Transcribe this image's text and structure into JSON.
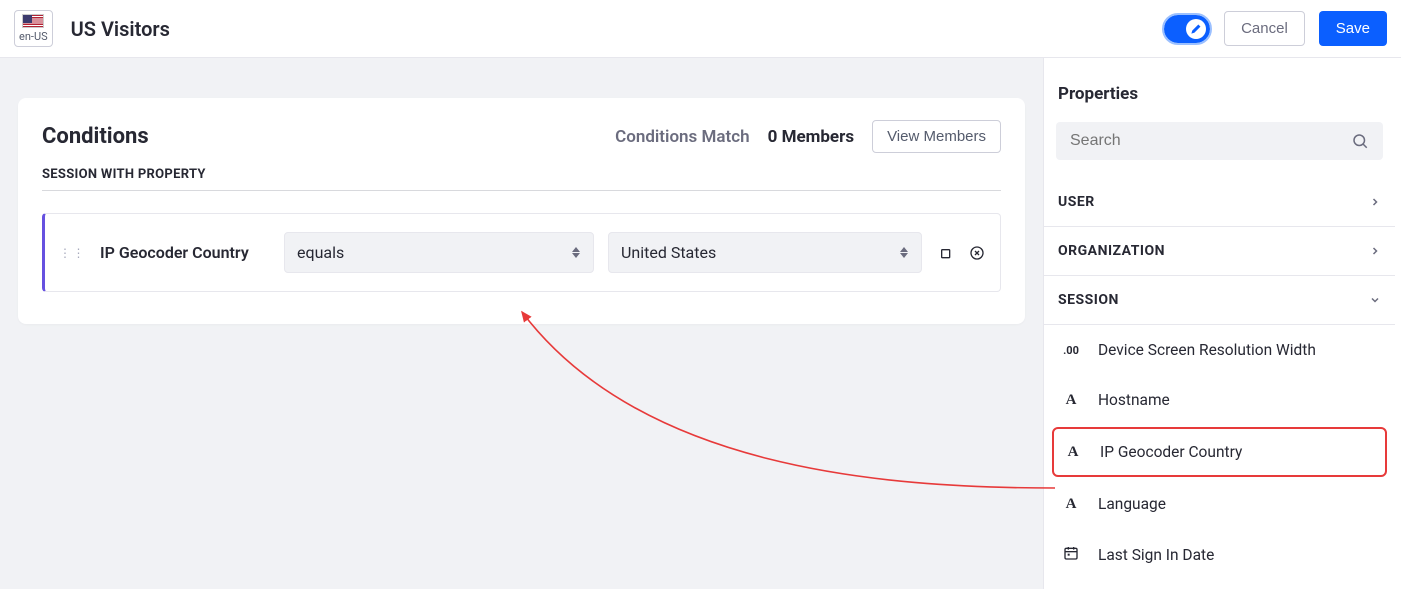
{
  "header": {
    "locale": "en-US",
    "title": "US Visitors",
    "cancel_label": "Cancel",
    "save_label": "Save"
  },
  "conditions": {
    "title": "Conditions",
    "match_label": "Conditions Match",
    "match_count": "0 Members",
    "view_members_label": "View Members",
    "section_label": "SESSION WITH PROPERTY",
    "row": {
      "property_label": "IP Geocoder Country",
      "operator": "equals",
      "value": "United States"
    }
  },
  "sidebar": {
    "title": "Properties",
    "search_placeholder": "Search",
    "groups": {
      "user": "USER",
      "organization": "ORGANIZATION",
      "session": "SESSION"
    },
    "session_items": [
      {
        "type": "num",
        "label": "Device Screen Resolution Width"
      },
      {
        "type": "text",
        "label": "Hostname"
      },
      {
        "type": "text",
        "label": "IP Geocoder Country",
        "highlighted": true
      },
      {
        "type": "text",
        "label": "Language"
      },
      {
        "type": "date",
        "label": "Last Sign In Date"
      }
    ]
  }
}
